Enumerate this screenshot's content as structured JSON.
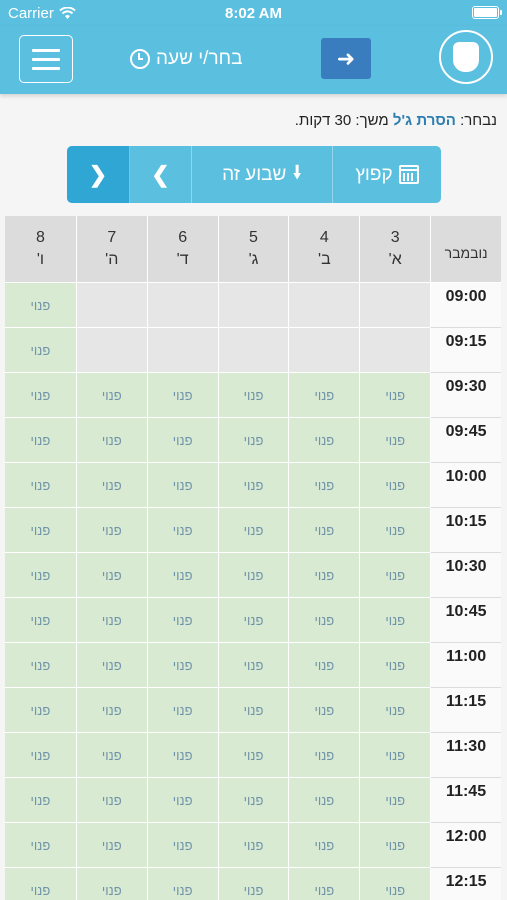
{
  "status": {
    "carrier": "Carrier",
    "time": "8:02 AM"
  },
  "header": {
    "title": "בחר/י שעה"
  },
  "selected": {
    "prefix": "נבחר:",
    "service": "הסרת ג'ל",
    "duration": "משך: 30 דקות."
  },
  "toolbar": {
    "jump_label": "קפוץ",
    "this_week_label": "שבוע זה"
  },
  "calendar": {
    "month": "נובמבר",
    "days": [
      {
        "num": "3",
        "letter": "א'"
      },
      {
        "num": "4",
        "letter": "ב'"
      },
      {
        "num": "5",
        "letter": "ג'"
      },
      {
        "num": "6",
        "letter": "ד'"
      },
      {
        "num": "7",
        "letter": "ה'"
      },
      {
        "num": "8",
        "letter": "ו'"
      }
    ],
    "free_label": "פנוי",
    "rows": [
      {
        "time": "09:00",
        "slots": [
          "",
          "",
          "",
          "",
          "",
          "פנוי"
        ]
      },
      {
        "time": "09:15",
        "slots": [
          "",
          "",
          "",
          "",
          "",
          "פנוי"
        ]
      },
      {
        "time": "09:30",
        "slots": [
          "פנוי",
          "פנוי",
          "פנוי",
          "פנוי",
          "פנוי",
          "פנוי"
        ]
      },
      {
        "time": "09:45",
        "slots": [
          "פנוי",
          "פנוי",
          "פנוי",
          "פנוי",
          "פנוי",
          "פנוי"
        ]
      },
      {
        "time": "10:00",
        "slots": [
          "פנוי",
          "פנוי",
          "פנוי",
          "פנוי",
          "פנוי",
          "פנוי"
        ]
      },
      {
        "time": "10:15",
        "slots": [
          "פנוי",
          "פנוי",
          "פנוי",
          "פנוי",
          "פנוי",
          "פנוי"
        ]
      },
      {
        "time": "10:30",
        "slots": [
          "פנוי",
          "פנוי",
          "פנוי",
          "פנוי",
          "פנוי",
          "פנוי"
        ]
      },
      {
        "time": "10:45",
        "slots": [
          "פנוי",
          "פנוי",
          "פנוי",
          "פנוי",
          "פנוי",
          "פנוי"
        ]
      },
      {
        "time": "11:00",
        "slots": [
          "פנוי",
          "פנוי",
          "פנוי",
          "פנוי",
          "פנוי",
          "פנוי"
        ]
      },
      {
        "time": "11:15",
        "slots": [
          "פנוי",
          "פנוי",
          "פנוי",
          "פנוי",
          "פנוי",
          "פנוי"
        ]
      },
      {
        "time": "11:30",
        "slots": [
          "פנוי",
          "פנוי",
          "פנוי",
          "פנוי",
          "פנוי",
          "פנוי"
        ]
      },
      {
        "time": "11:45",
        "slots": [
          "פנוי",
          "פנוי",
          "פנוי",
          "פנוי",
          "פנוי",
          "פנוי"
        ]
      },
      {
        "time": "12:00",
        "slots": [
          "פנוי",
          "פנוי",
          "פנוי",
          "פנוי",
          "פנוי",
          "פנוי"
        ]
      },
      {
        "time": "12:15",
        "slots": [
          "פנוי",
          "פנוי",
          "פנוי",
          "פנוי",
          "פנוי",
          "פנוי"
        ]
      }
    ]
  }
}
